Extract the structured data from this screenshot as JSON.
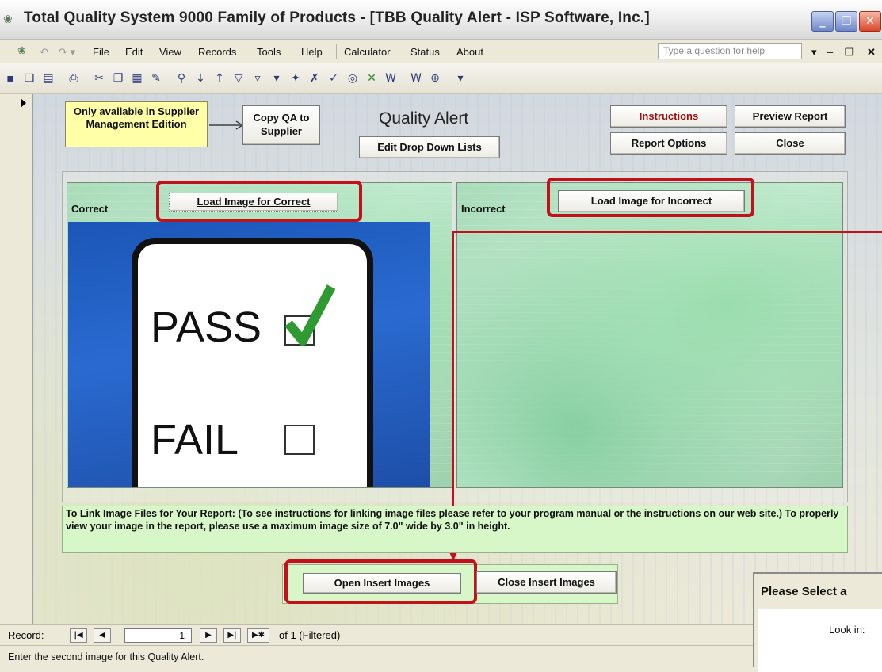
{
  "window": {
    "title": "Total Quality System 9000 Family of Products - [TBB Quality Alert - ISP Software, Inc.]",
    "controls": [
      "minimize",
      "restore",
      "close"
    ]
  },
  "menu": {
    "items": [
      "File",
      "Edit",
      "View",
      "Records",
      "Tools",
      "Help",
      "Calculator",
      "Status",
      "About"
    ],
    "help_placeholder": "Type a question for help"
  },
  "toolbar": {
    "icons": [
      "save-icon",
      "form-view-icon",
      "print-preview-icon",
      "print-icon",
      "cut-icon",
      "copy-icon",
      "paste-icon",
      "format-painter-icon",
      "find-icon",
      "sort-ascending-icon",
      "sort-descending-icon",
      "filter-icon",
      "filter-by-form-icon",
      "apply-filter-icon",
      "new-record-icon",
      "delete-record-icon",
      "spelling-icon",
      "word-icon",
      "excel-icon",
      "new-object-icon"
    ]
  },
  "form": {
    "supplier_note": "Only available in Supplier Management Edition",
    "copy_qa_button": "Copy QA to Supplier",
    "title": "Quality Alert",
    "edit_dropdown_button": "Edit Drop Down Lists",
    "instructions_button": "Instructions",
    "preview_report_button": "Preview Report",
    "report_options_button": "Report Options",
    "close_button": "Close",
    "correct_label": "Correct",
    "incorrect_label": "Incorrect",
    "load_correct_button": "Load Image for Correct",
    "load_incorrect_button": "Load Image for Incorrect",
    "correct_image": {
      "pass_word": "PASS",
      "fail_word": "FAIL"
    },
    "instructions_text": "To Link Image Files for Your Report: (To see instructions for linking image files please refer to your program manual or the instructions on our web site.) To properly view your image in the report, please use a maximum image size of 7.0\" wide by 3.0\" in height.",
    "open_insert_button": "Open Insert Images",
    "close_insert_button": "Close Insert Images"
  },
  "dialog": {
    "title": "Please Select a",
    "look_in_label": "Look in:"
  },
  "navigation": {
    "record_label": "Record:",
    "current_record": "1",
    "total_text": "of 1 (Filtered)"
  },
  "status": {
    "text": "Enter the second image for this Quality Alert."
  },
  "colors": {
    "highlight": "#c3101a",
    "green_panel": "#d8f7c8",
    "note_yellow": "#ffffa8"
  }
}
